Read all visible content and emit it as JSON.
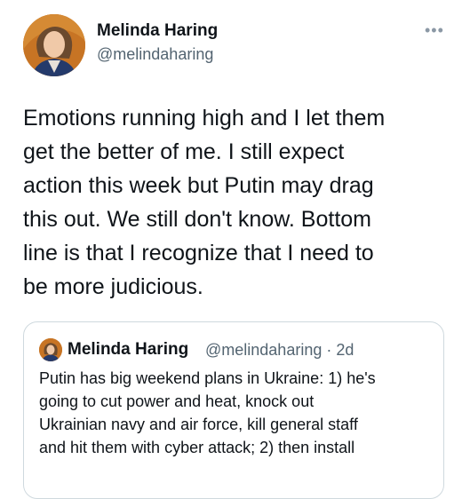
{
  "author": {
    "name": "Melinda Haring",
    "handle": "@melindaharing"
  },
  "tweet": {
    "text": "Emotions running high and I let them\nget the better of me. I still expect\naction this week but Putin may drag\nthis out. We still don't know. Bottom\nline is that I recognize that I need to\nbe more judicious."
  },
  "quoted_tweet": {
    "name": "Melinda Haring",
    "handle": "@melindaharing",
    "separator": "·",
    "time": "2d",
    "text": "Putin has big weekend plans in Ukraine: 1) he's\ngoing to cut power and heat, knock out\nUkrainian navy and air force, kill general staff\nand hit them with cyber attack; 2) then install"
  },
  "icons": {
    "more": "more-horizontal-icon"
  }
}
